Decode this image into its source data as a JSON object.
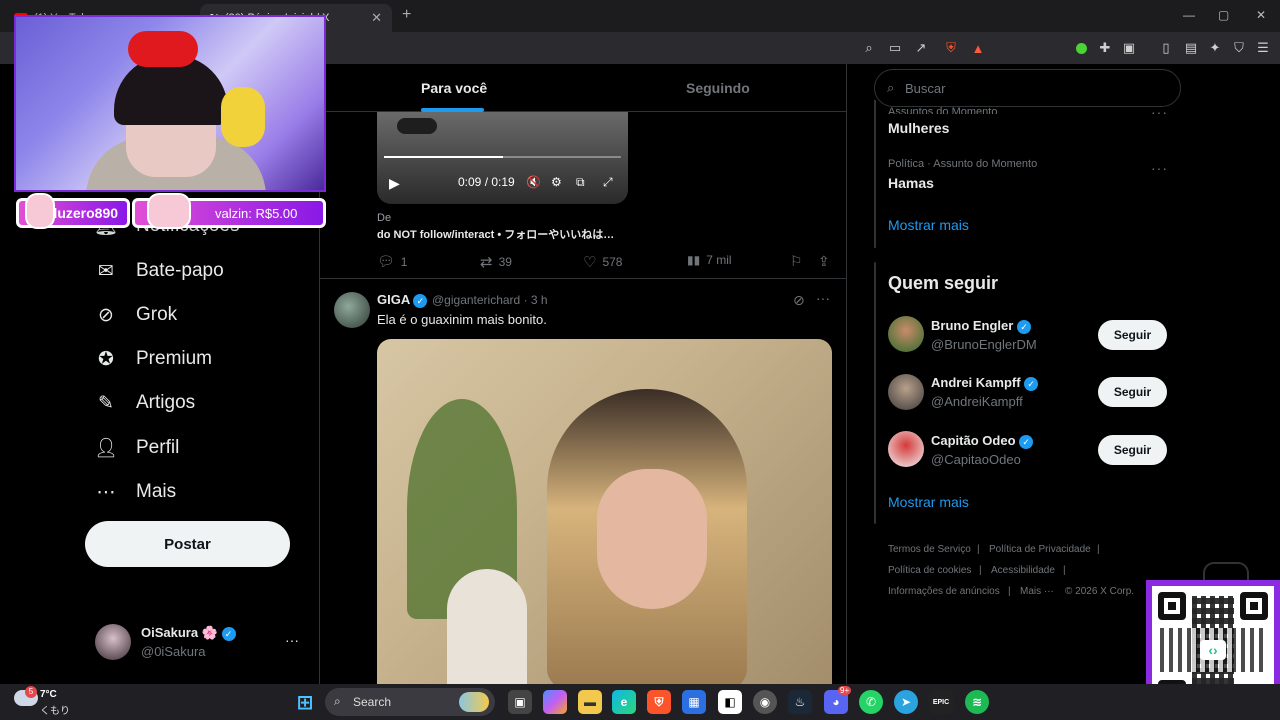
{
  "browser": {
    "tabs": [
      {
        "label": "(1) YouTube"
      },
      {
        "label": "(20) Página Inicial / X"
      }
    ],
    "new_tab": "+",
    "window_controls": {
      "minimize": "—",
      "maximize": "▢",
      "close": "✕"
    },
    "brave_badge": "1"
  },
  "stream_overlay": {
    "alerts": [
      {
        "text": "eduzero890"
      },
      {
        "text": "valzin: R$5.00"
      }
    ]
  },
  "nav": {
    "items": [
      {
        "label": "Notificações",
        "icon": "bell-icon"
      },
      {
        "label": "Bate-papo",
        "icon": "mail-icon"
      },
      {
        "label": "Grok",
        "icon": "grok-icon"
      },
      {
        "label": "Premium",
        "icon": "verified-badge-icon"
      },
      {
        "label": "Artigos",
        "icon": "article-icon"
      },
      {
        "label": "Perfil",
        "icon": "person-icon"
      },
      {
        "label": "Mais",
        "icon": "more-circle-icon"
      }
    ],
    "post_label": "Postar",
    "profile": {
      "name": "OiSakura 🌸",
      "handle": "@0iSakura",
      "more": "···"
    }
  },
  "feed": {
    "tabs": [
      "Para você",
      "Seguindo"
    ],
    "video": {
      "time": "0:09 / 0:19",
      "progress": 0.5
    },
    "source_label": "De",
    "source_title": "do NOT follow/interact • フォローやいいねは…",
    "actions": {
      "replies": "1",
      "reposts": "39",
      "likes": "578",
      "views": "7 mil"
    },
    "tweet": {
      "name": "GIGA",
      "handle": "@giganterichard · 3 h",
      "text": "Ela é o guaxinim mais bonito.",
      "more": "···"
    }
  },
  "sidebar": {
    "search_placeholder": "Buscar",
    "trends": [
      {
        "category": "Assuntos do Momento",
        "name": "Mulheres"
      },
      {
        "category": "Política · Assunto do Momento",
        "name": "Hamas"
      }
    ],
    "trends_more": "Mostrar mais",
    "who_to_follow": {
      "title": "Quem seguir",
      "users": [
        {
          "name": "Bruno Engler",
          "handle": "@BrunoEnglerDM",
          "button": "Seguir"
        },
        {
          "name": "Andrei Kampff",
          "handle": "@AndreiKampff",
          "button": "Seguir"
        },
        {
          "name": "Capitão Odeo",
          "handle": "@CapitaoOdeo",
          "button": "Seguir"
        }
      ],
      "more": "Mostrar mais"
    },
    "footer": [
      "Termos de Serviço",
      "|",
      "Política de Privacidade",
      "|",
      "Política de cookies",
      "|",
      "Acessibilidade",
      "|",
      "Informações de anúncios",
      "|",
      "Mais ···",
      "© 2026 X Corp."
    ]
  },
  "taskbar": {
    "weather": {
      "temp": "7°C",
      "desc": "くもり",
      "badge": "5"
    },
    "search_label": "Search",
    "discord_badge": "9+"
  },
  "colors": {
    "accent": "#1d9bf0",
    "background": "#000000",
    "border": "#2f3336",
    "muted": "#71767b",
    "overlay_purple": "#8a2be2"
  }
}
